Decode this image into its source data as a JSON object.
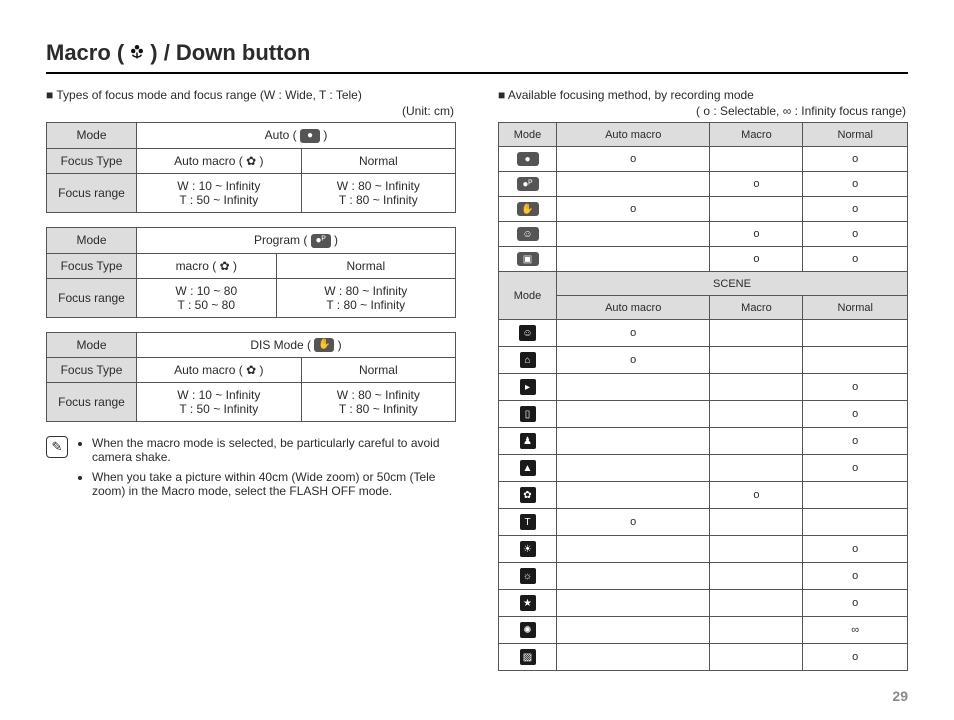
{
  "title_a": "Macro (",
  "title_b": ") / Down button",
  "left": {
    "intro": "Types of focus mode and focus range (W : Wide, T : Tele)",
    "unit": "(Unit: cm)",
    "labels": {
      "mode": "Mode",
      "focus_type": "Focus Type",
      "focus_range": "Focus range"
    },
    "tables": [
      {
        "mode_label": "Auto (",
        "mode_icon": "●",
        "mode_label_after": ")",
        "types": [
          "Auto macro (",
          "Normal"
        ],
        "type_icon": "✿",
        "type_after": ")",
        "ranges": [
          "W : 10 ~ Infinity\nT  : 50 ~ Infinity",
          "W : 80 ~ Infinity\nT  : 80 ~ Infinity"
        ]
      },
      {
        "mode_label": "Program (",
        "mode_icon": "●ᴾ",
        "mode_label_after": ")",
        "types": [
          "macro (",
          "Normal"
        ],
        "type_icon": "✿",
        "type_after": ")",
        "ranges": [
          "W : 10 ~ 80\nT  : 50 ~ 80",
          "W : 80 ~ Infinity\nT  : 80 ~ Infinity"
        ]
      },
      {
        "mode_label": "DIS Mode (",
        "mode_icon": "✋",
        "mode_label_after": ")",
        "types": [
          "Auto macro (",
          "Normal"
        ],
        "type_icon": "✿",
        "type_after": ")",
        "ranges": [
          "W : 10 ~ Infinity\nT  : 50 ~ Infinity",
          "W : 80 ~ Infinity\nT  : 80 ~ Infinity"
        ]
      }
    ],
    "note": [
      "When the macro mode is selected, be particularly careful to avoid camera shake.",
      "When you take a picture within 40cm (Wide zoom) or 50cm (Tele zoom) in the Macro mode, select the FLASH OFF mode."
    ]
  },
  "right": {
    "intro": "Available focusing method, by recording mode",
    "legend": "( o : Selectable, ∞ : Infinity focus range)",
    "headers": [
      "Mode",
      "Auto macro",
      "Macro",
      "Normal"
    ],
    "scene_label": "SCENE",
    "top_rows": [
      {
        "icon": "●",
        "auto": "o",
        "macro": "",
        "normal": "o"
      },
      {
        "icon": "●ᴾ",
        "auto": "",
        "macro": "o",
        "normal": "o"
      },
      {
        "icon": "✋",
        "auto": "o",
        "macro": "",
        "normal": "o"
      },
      {
        "icon": "☺",
        "auto": "",
        "macro": "o",
        "normal": "o"
      },
      {
        "icon": "▣",
        "auto": "",
        "macro": "o",
        "normal": "o"
      }
    ],
    "scene_rows": [
      {
        "icon": "☺",
        "auto": "o",
        "macro": "",
        "normal": ""
      },
      {
        "icon": "⌂",
        "auto": "o",
        "macro": "",
        "normal": ""
      },
      {
        "icon": "▸",
        "auto": "",
        "macro": "",
        "normal": "o"
      },
      {
        "icon": "▯",
        "auto": "",
        "macro": "",
        "normal": "o"
      },
      {
        "icon": "♟",
        "auto": "",
        "macro": "",
        "normal": "o"
      },
      {
        "icon": "▲",
        "auto": "",
        "macro": "",
        "normal": "o"
      },
      {
        "icon": "✿",
        "auto": "",
        "macro": "o",
        "normal": ""
      },
      {
        "icon": "T",
        "auto": "o",
        "macro": "",
        "normal": ""
      },
      {
        "icon": "☀",
        "auto": "",
        "macro": "",
        "normal": "o"
      },
      {
        "icon": "☼",
        "auto": "",
        "macro": "",
        "normal": "o"
      },
      {
        "icon": "★",
        "auto": "",
        "macro": "",
        "normal": "o"
      },
      {
        "icon": "✺",
        "auto": "",
        "macro": "",
        "normal": "∞"
      },
      {
        "icon": "▨",
        "auto": "",
        "macro": "",
        "normal": "o"
      }
    ]
  },
  "page_number": "29"
}
